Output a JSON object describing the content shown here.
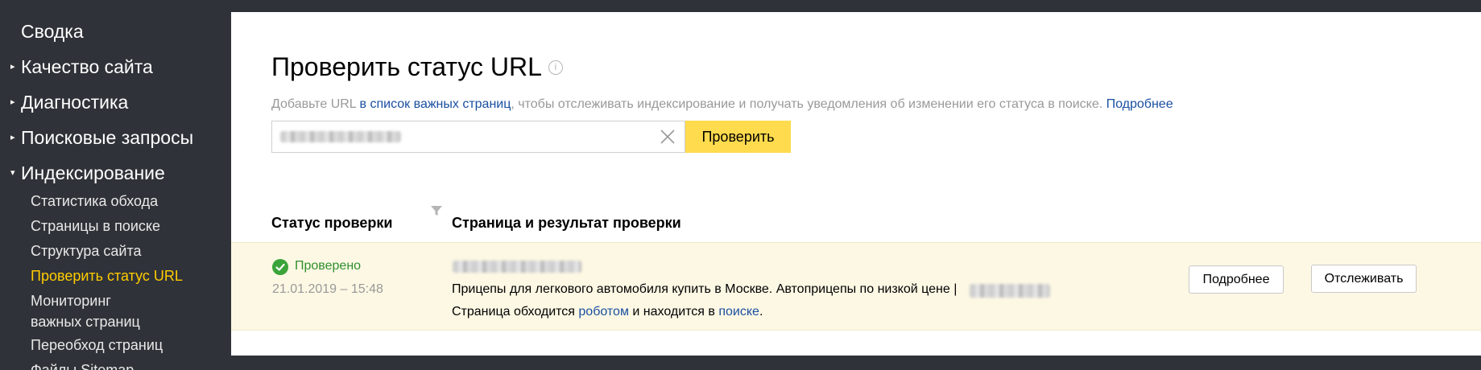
{
  "sidebar": {
    "top_items": [
      {
        "label": "Сводка"
      },
      {
        "label": "Качество сайта"
      },
      {
        "label": "Диагностика"
      },
      {
        "label": "Поисковые запросы"
      },
      {
        "label": "Индексирование"
      }
    ],
    "collapsed_caret": "▸",
    "expanded_caret": "▾",
    "sub_items": [
      {
        "label": "Статистика обхода"
      },
      {
        "label": "Страницы в поиске"
      },
      {
        "label": "Структура сайта"
      },
      {
        "label": "Проверить статус URL",
        "active": true
      },
      {
        "label": "Мониторинг"
      },
      {
        "label": "важных страниц"
      },
      {
        "label": "Переобход страниц"
      },
      {
        "label": "Файлы Sitemap"
      }
    ]
  },
  "header": {
    "title": "Проверить статус URL",
    "info_icon": "info-icon",
    "subtitle_prefix": "Добавьте URL ",
    "subtitle_link": "в список важных страниц",
    "subtitle_middle": ", чтобы отслеживать индексирование и получать уведомления об изменении его статуса в поиске. ",
    "subtitle_more": "Подробнее"
  },
  "search": {
    "value": "",
    "clear_icon": "close-icon",
    "button_label": "Проверить"
  },
  "table": {
    "col_status": "Статус проверки",
    "col_page": "Страница и результат проверки",
    "filter_icon": "filter-icon"
  },
  "result": {
    "status": "Проверено",
    "status_icon": "check-circle-icon",
    "date": "21.01.2019 – 15:48",
    "page_title": "Прицепы для легкового автомобиля купить в Москве. Автоприцепы по низкой цене |",
    "page_status_prefix": "Страница обходится ",
    "page_status_link1": "роботом",
    "page_status_middle": " и находится в ",
    "page_status_link2": "поиске",
    "page_status_suffix": ".",
    "details_button": "Подробнее",
    "track_button": "Отслеживать"
  },
  "colors": {
    "sidebar_bg": "#2f3238",
    "active_item": "#ffcc00",
    "accent_button": "#ffdb4d",
    "link": "#1a4fa0",
    "success": "#2f8f2f",
    "result_bg": "#fdf8e4"
  }
}
